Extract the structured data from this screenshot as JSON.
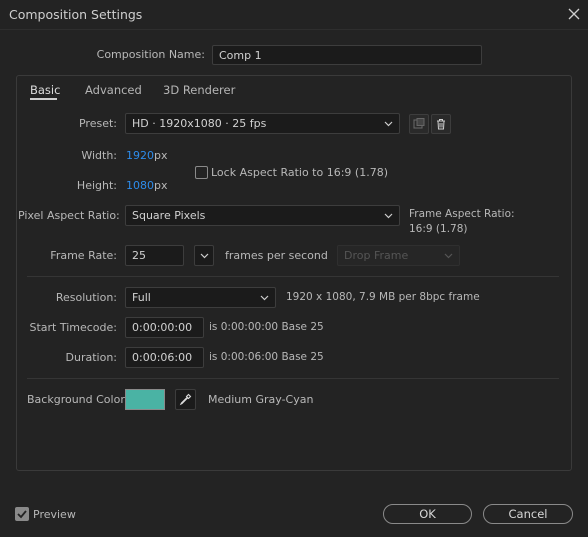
{
  "window": {
    "title": "Composition Settings"
  },
  "composition_name": {
    "label": "Composition Name:",
    "value": "Comp 1"
  },
  "tabs": [
    {
      "label": "Basic",
      "active": true
    },
    {
      "label": "Advanced",
      "active": false
    },
    {
      "label": "3D Renderer",
      "active": false
    }
  ],
  "preset": {
    "label": "Preset:",
    "value": "HD  ·  1920x1080 · 25 fps"
  },
  "width": {
    "label": "Width:",
    "value": "1920",
    "unit": "px"
  },
  "height": {
    "label": "Height:",
    "value": "1080",
    "unit": "px"
  },
  "lock_aspect": {
    "label": "Lock Aspect Ratio to 16:9 (1.78)",
    "checked": false
  },
  "pixel_aspect": {
    "label": "Pixel Aspect Ratio:",
    "value": "Square Pixels"
  },
  "frame_aspect": {
    "label": "Frame Aspect Ratio:",
    "value": "16:9 (1.78)"
  },
  "frame_rate": {
    "label": "Frame Rate:",
    "value": "25",
    "unit": "frames per second",
    "drop_frame": "Drop Frame"
  },
  "resolution": {
    "label": "Resolution:",
    "value": "Full",
    "info": "1920 x 1080, 7.9 MB per 8bpc frame"
  },
  "start_timecode": {
    "label": "Start Timecode:",
    "value": "0:00:00:00",
    "info": "is 0:00:00:00  Base 25"
  },
  "duration": {
    "label": "Duration:",
    "value": "0:00:06:00",
    "info": "is 0:00:06:00  Base 25"
  },
  "background_color": {
    "label": "Background Color:",
    "name": "Medium Gray-Cyan",
    "color": "#4ab3a4"
  },
  "preview": {
    "label": "Preview",
    "checked": true
  },
  "buttons": {
    "ok": "OK",
    "cancel": "Cancel"
  },
  "colors": {
    "accent_blue": "#2d8ceb",
    "background": "#232323"
  }
}
